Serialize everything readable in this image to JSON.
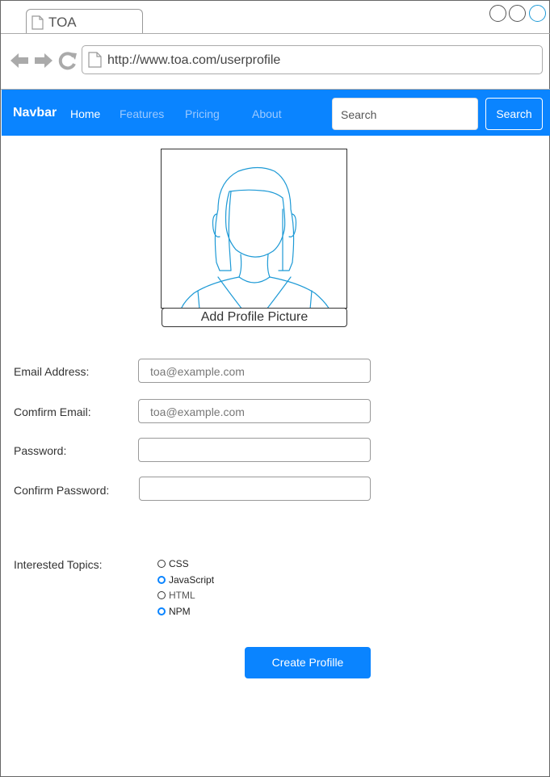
{
  "window": {
    "tab_title": "TOA",
    "url": "http://www.toa.com/userprofile"
  },
  "navbar": {
    "brand": "Navbar",
    "links": [
      "Home",
      "Features",
      "Pricing",
      "About"
    ],
    "search_placeholder": "Search",
    "search_button": "Search"
  },
  "profile": {
    "add_picture_label": "Add Profile Picture"
  },
  "form": {
    "email_label": "Email Address:",
    "email_placeholder": "toa@example.com",
    "confirm_email_label": "Comfirm Email:",
    "confirm_email_placeholder": "toa@example.com",
    "password_label": "Password:",
    "confirm_password_label": "Confirm Password:",
    "topics_label": "Interested Topics:",
    "topics": [
      {
        "label": "CSS",
        "checked": false
      },
      {
        "label": "JavaScript",
        "checked": true
      },
      {
        "label": "HTML",
        "checked": false
      },
      {
        "label": "NPM",
        "checked": true
      }
    ],
    "submit_label": "Create Profille"
  },
  "colors": {
    "accent": "#0a84ff",
    "sketch_line": "#1e9ad6"
  }
}
